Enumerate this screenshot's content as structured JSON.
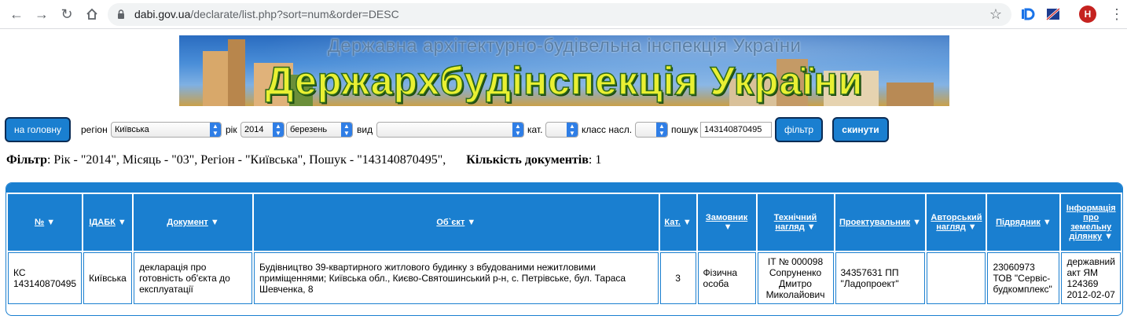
{
  "browser": {
    "url_host": "dabi.gov.ua",
    "url_path": "/declarate/list.php?sort=num&order=DESC",
    "avatar_letter": "H"
  },
  "banner": {
    "subtitle": "Державна архітектурно-будівельна інспекція України",
    "title": "Держархбудінспекція України"
  },
  "filter_bar": {
    "home_button": "на головну",
    "region_label": "регіон",
    "region_value": "Київська",
    "year_label": "рік",
    "year_value": "2014",
    "month_value": "березень",
    "type_label": "вид",
    "type_value": "",
    "cat_label": "кат.",
    "cat_value": "",
    "class_label": "класс насл.",
    "class_value": "",
    "search_label": "пошук",
    "search_value": "143140870495",
    "filter_button": "фільтр",
    "reset_button": "скинути"
  },
  "summary": {
    "filter_label": "Фільтр",
    "filter_text": ": Рік - \"2014\", Місяць - \"03\", Регіон - \"Київська\", Пошук - \"143140870495\",",
    "count_label": "Кількість документів",
    "count_value": ": 1"
  },
  "table": {
    "headers": [
      "№",
      "ІДАБК",
      "Документ",
      "Об`єкт",
      "Кат.",
      "Замовник",
      "Технічний нагляд",
      "Проектувальник",
      "Авторський нагляд",
      "Підрядник",
      "Інформація про земельну ділянку"
    ],
    "rows": [
      {
        "num": "КС 143140870495",
        "idabk": "Київська",
        "document": "декларація про готовність об'єкта до експлуатації",
        "object": "Будівництво 39-квартирного житлового будинку з вбудованими нежитловими приміщеннями; Київська обл., Києво-Святошинський р-н, с. Петрівське, бул. Тараса Шевченка, 8",
        "cat": "3",
        "customer": "Фізична особа",
        "tech_supervision": "ІТ № 000098 Сопруненко Дмитро Миколайович",
        "designer": "34357631 ПП \"Ладопроект\"",
        "author_supervision": "",
        "contractor": "23060973 ТОВ \"Сервіс-будкомплекс\"",
        "land_info": "державний акт ЯМ 124369 2012-02-07"
      }
    ]
  },
  "colors": {
    "accent": "#1a7fd0",
    "button_border": "#0b2c55"
  }
}
